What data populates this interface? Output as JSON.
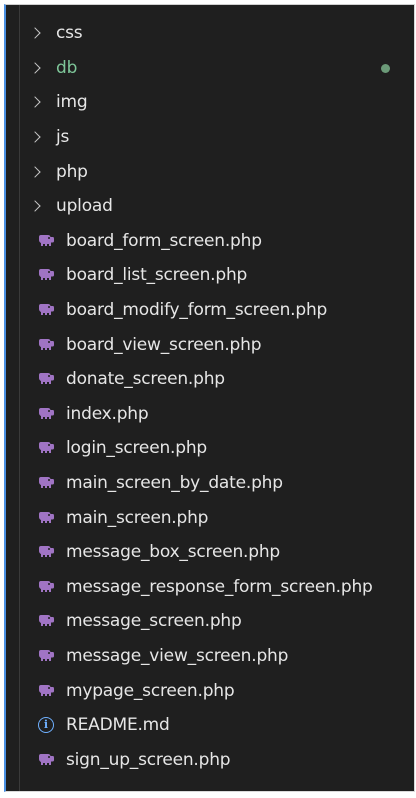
{
  "colors": {
    "background": "#1f1f1f",
    "text": "#e6e6e6",
    "modified": "#7ec699",
    "php_icon": "#a074c4",
    "info_icon": "#6fb0ff"
  },
  "folders": [
    {
      "label": "css",
      "icon": "chevron-right-icon"
    },
    {
      "label": "db",
      "icon": "chevron-right-icon",
      "modified": true
    },
    {
      "label": "img",
      "icon": "chevron-right-icon"
    },
    {
      "label": "js",
      "icon": "chevron-right-icon"
    },
    {
      "label": "php",
      "icon": "chevron-right-icon"
    },
    {
      "label": "upload",
      "icon": "chevron-right-icon"
    }
  ],
  "files": [
    {
      "label": "board_form_screen.php",
      "icon": "php-elephant-icon"
    },
    {
      "label": "board_list_screen.php",
      "icon": "php-elephant-icon"
    },
    {
      "label": "board_modify_form_screen.php",
      "icon": "php-elephant-icon"
    },
    {
      "label": "board_view_screen.php",
      "icon": "php-elephant-icon"
    },
    {
      "label": "donate_screen.php",
      "icon": "php-elephant-icon"
    },
    {
      "label": "index.php",
      "icon": "php-elephant-icon"
    },
    {
      "label": "login_screen.php",
      "icon": "php-elephant-icon"
    },
    {
      "label": "main_screen_by_date.php",
      "icon": "php-elephant-icon"
    },
    {
      "label": "main_screen.php",
      "icon": "php-elephant-icon"
    },
    {
      "label": "message_box_screen.php",
      "icon": "php-elephant-icon"
    },
    {
      "label": "message_response_form_screen.php",
      "icon": "php-elephant-icon"
    },
    {
      "label": "message_screen.php",
      "icon": "php-elephant-icon"
    },
    {
      "label": "message_view_screen.php",
      "icon": "php-elephant-icon"
    },
    {
      "label": "mypage_screen.php",
      "icon": "php-elephant-icon"
    },
    {
      "label": "README.md",
      "icon": "info-icon"
    },
    {
      "label": "sign_up_screen.php",
      "icon": "php-elephant-icon"
    }
  ]
}
